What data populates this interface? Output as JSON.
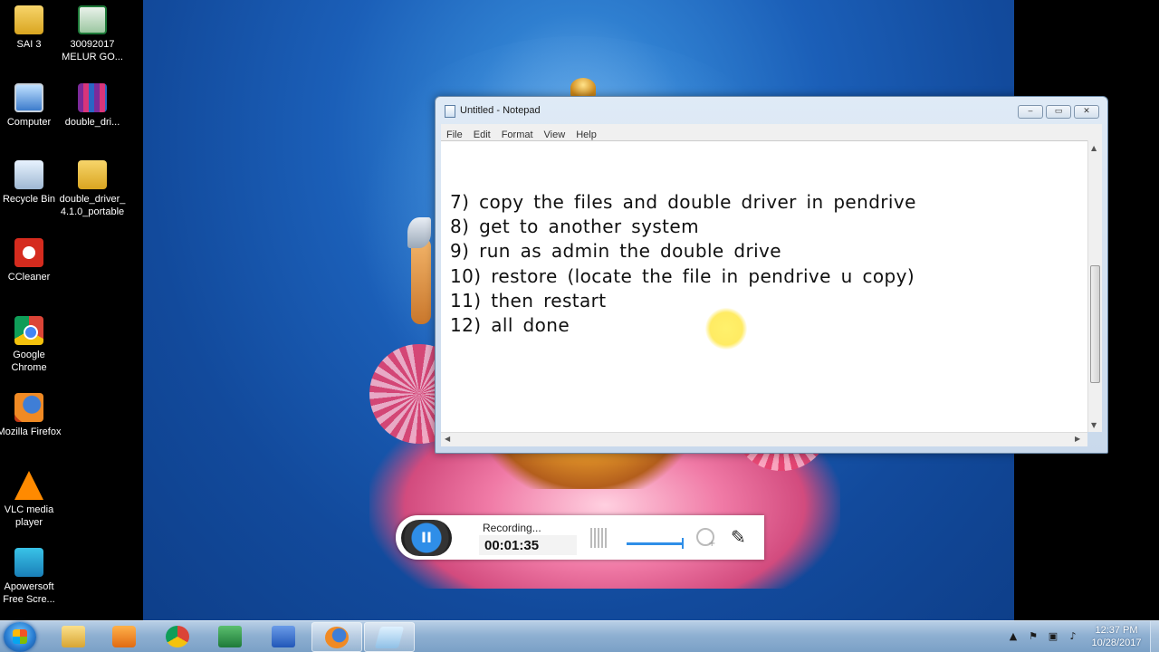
{
  "desktop_icons": [
    {
      "label": "SAI 3",
      "icon": "folder-icon"
    },
    {
      "label": "30092017 MELUR GO...",
      "icon": "excel-file-icon"
    },
    {
      "label": "Computer",
      "icon": "computer-icon"
    },
    {
      "label": "double_dri...",
      "icon": "winrar-archive-icon"
    },
    {
      "label": "Recycle Bin",
      "icon": "recycle-bin-icon"
    },
    {
      "label": "double_driver_4.1.0_portable",
      "icon": "folder-icon"
    },
    {
      "label": "CCleaner",
      "icon": "ccleaner-icon"
    },
    {
      "label": "Google Chrome",
      "icon": "chrome-icon"
    },
    {
      "label": "Mozilla Firefox",
      "icon": "firefox-icon"
    },
    {
      "label": "VLC media player",
      "icon": "vlc-icon"
    },
    {
      "label": "Apowersoft Free Scre...",
      "icon": "apowersoft-icon"
    }
  ],
  "notepad": {
    "title": "Untitled - Notepad",
    "menu": [
      "File",
      "Edit",
      "Format",
      "View",
      "Help"
    ],
    "lines": [
      "7) copy the files and double driver in pendrive",
      "8) get to another system",
      "9) run as admin the double drive",
      "10) restore (locate the file in pendrive u copy)",
      "11) then restart",
      "12) all done"
    ],
    "controls": {
      "minimize": "‒",
      "maximize": "▭",
      "close": "✕"
    }
  },
  "recorder": {
    "status": "Recording...",
    "elapsed": "00:01:35",
    "pause_glyph": "II",
    "accent_color": "#2f8ee8"
  },
  "taskbar": {
    "apps": [
      "windows-explorer",
      "windows-media-player",
      "google-chrome",
      "microsoft-excel",
      "microsoft-word",
      "mozilla-firefox",
      "notepad"
    ],
    "active_apps": [
      "mozilla-firefox",
      "notepad"
    ],
    "clock_time": "12:37 PM",
    "clock_date": "10/28/2017"
  }
}
